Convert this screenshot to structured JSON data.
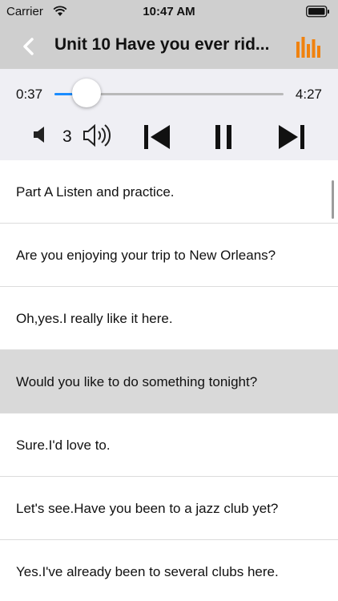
{
  "status_bar": {
    "carrier": "Carrier",
    "time": "10:47 AM",
    "wifi_icon": "wifi-icon",
    "battery_icon": "battery-icon"
  },
  "nav": {
    "title": "Unit 10 Have you ever rid...",
    "back_icon": "chevron-left-icon",
    "menu_icon": "equalizer-icon",
    "accent_color": "#f0820f"
  },
  "player": {
    "elapsed": "0:37",
    "total": "4:27",
    "progress": 0.14,
    "volume_level": "3",
    "progress_color": "#1a8cff"
  },
  "lines": [
    {
      "text": "Part A  Listen and practice.",
      "selected": false
    },
    {
      "text": "Are you enjoying your trip to New Orleans?",
      "selected": false
    },
    {
      "text": "Oh,yes.I really like it here.",
      "selected": false
    },
    {
      "text": "Would you like to do something tonight?",
      "selected": true
    },
    {
      "text": "Sure.I'd love to.",
      "selected": false
    },
    {
      "text": "Let's see.Have you been to a jazz club yet?",
      "selected": false
    },
    {
      "text": "Yes.I've already been to several clubs here.",
      "selected": false
    }
  ]
}
